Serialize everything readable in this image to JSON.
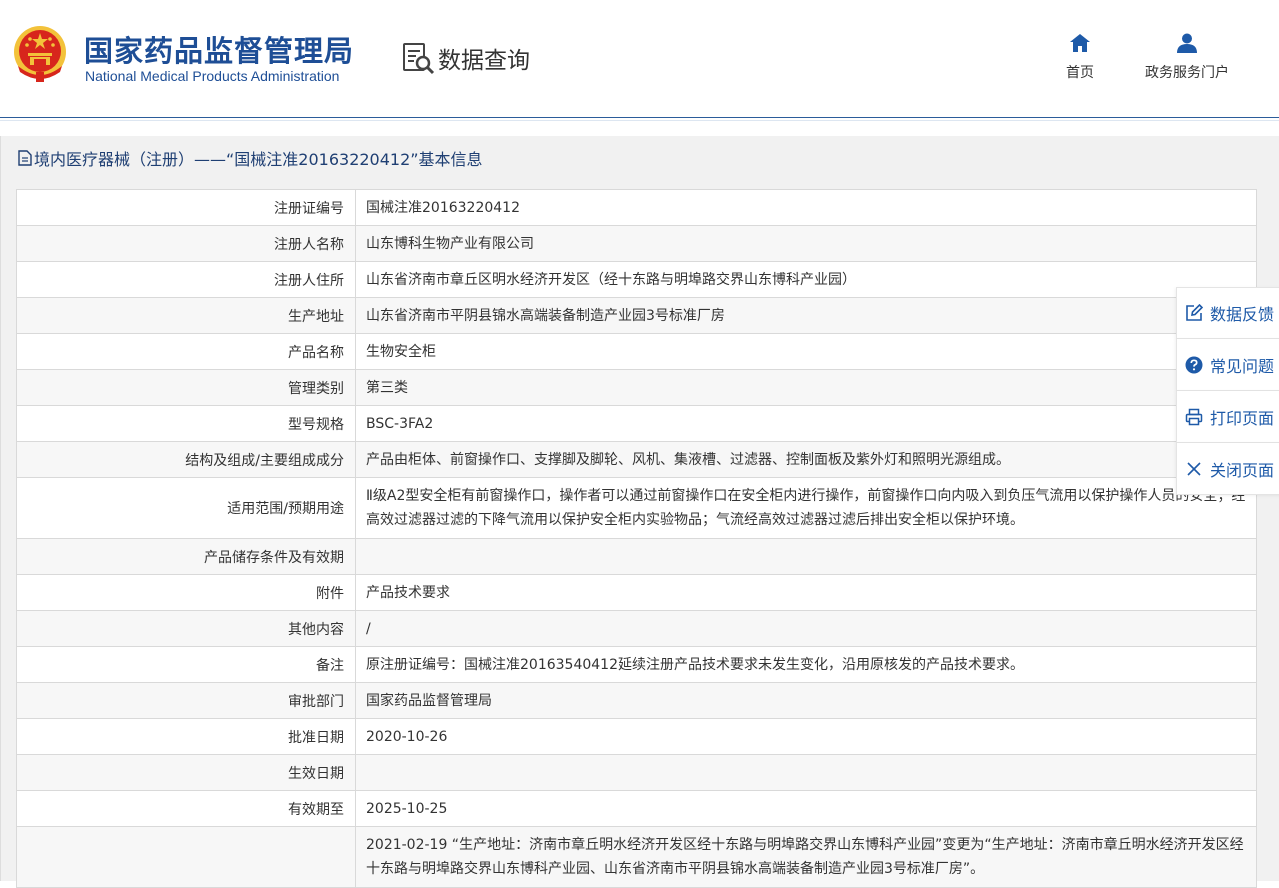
{
  "header": {
    "org_name_cn": "国家药品监督管理局",
    "org_name_en": "National Medical Products Administration",
    "query_label": "数据查询",
    "nav": [
      {
        "label": "首页",
        "icon": "home-icon"
      },
      {
        "label": "政务服务门户",
        "icon": "user-icon"
      }
    ]
  },
  "panel": {
    "title": "境内医疗器械（注册）——“国械注准20163220412”基本信息"
  },
  "details": [
    {
      "key": "注册证编号",
      "value": "国械注准20163220412"
    },
    {
      "key": "注册人名称",
      "value": "山东博科生物产业有限公司"
    },
    {
      "key": "注册人住所",
      "value": "山东省济南市章丘区明水经济开发区（经十东路与明埠路交界山东博科产业园）"
    },
    {
      "key": "生产地址",
      "value": "山东省济南市平阴县锦水高端装备制造产业园3号标准厂房"
    },
    {
      "key": "产品名称",
      "value": "生物安全柜"
    },
    {
      "key": "管理类别",
      "value": "第三类"
    },
    {
      "key": "型号规格",
      "value": "BSC-3FA2"
    },
    {
      "key": "结构及组成/主要组成成分",
      "value": "产品由柜体、前窗操作口、支撑脚及脚轮、风机、集液槽、过滤器、控制面板及紫外灯和照明光源组成。"
    },
    {
      "key": "适用范围/预期用途",
      "value": "Ⅱ级A2型安全柜有前窗操作口，操作者可以通过前窗操作口在安全柜内进行操作，前窗操作口向内吸入到负压气流用以保护操作人员的安全；经高效过滤器过滤的下降气流用以保护安全柜内实验物品；气流经高效过滤器过滤后排出安全柜以保护环境。"
    },
    {
      "key": "产品储存条件及有效期",
      "value": ""
    },
    {
      "key": "附件",
      "value": "产品技术要求"
    },
    {
      "key": "其他内容",
      "value": "/"
    },
    {
      "key": "备注",
      "value": "原注册证编号：国械注准20163540412延续注册产品技术要求未发生变化，沿用原核发的产品技术要求。"
    },
    {
      "key": "审批部门",
      "value": "国家药品监督管理局"
    },
    {
      "key": "批准日期",
      "value": "2020-10-26"
    },
    {
      "key": "生效日期",
      "value": ""
    },
    {
      "key": "有效期至",
      "value": "2025-10-25"
    },
    {
      "key": "",
      "value": "2021-02-19 “生产地址：济南市章丘明水经济开发区经十东路与明埠路交界山东博科产业园”变更为“生产地址：济南市章丘明水经济开发区经十东路与明埠路交界山东博科产业园、山东省济南市平阴县锦水高端装备制造产业园3号标准厂房”。"
    }
  ],
  "float_menu": [
    {
      "label": "数据反馈",
      "icon": "edit-icon"
    },
    {
      "label": "常见问题",
      "icon": "question-icon"
    },
    {
      "label": "打印页面",
      "icon": "printer-icon"
    },
    {
      "label": "关闭页面",
      "icon": "close-icon"
    }
  ],
  "colors": {
    "brand_blue": "#1e4e96",
    "emblem_red": "#d7261c",
    "emblem_gold": "#f3c23a",
    "link_blue": "#1e5aa8"
  }
}
